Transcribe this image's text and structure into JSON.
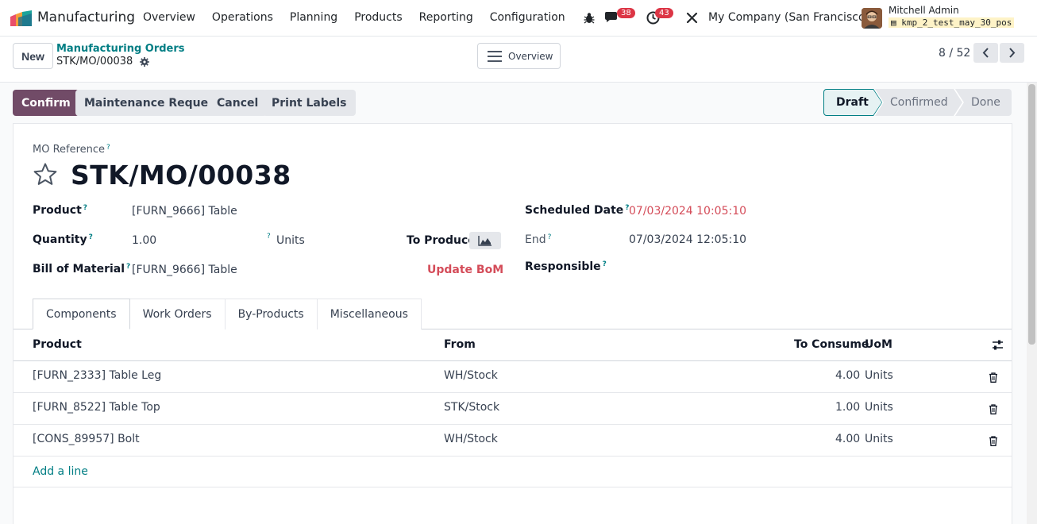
{
  "navbar": {
    "app_name": "Manufacturing",
    "menu": [
      "Overview",
      "Operations",
      "Planning",
      "Products",
      "Reporting",
      "Configuration"
    ],
    "messages_count": "38",
    "activities_count": "43",
    "company": "My Company (San Francisco)",
    "user_name": "Mitchell Admin",
    "database": "kmp_2_test_may_30_pos"
  },
  "control": {
    "new_label": "New",
    "breadcrumb_parent": "Manufacturing Orders",
    "breadcrumb_current": "STK/MO/00038",
    "overview_label": "Overview",
    "pager": "8 / 52"
  },
  "actions": {
    "confirm": "Confirm",
    "maintenance": "Maintenance Request",
    "cancel": "Cancel",
    "print_labels": "Print Labels"
  },
  "stages": [
    "Draft",
    "Confirmed",
    "Done"
  ],
  "stage_active": "Draft",
  "form": {
    "reference_label": "MO Reference",
    "reference": "STK/MO/00038",
    "product_label": "Product",
    "product": "[FURN_9666] Table",
    "quantity_label": "Quantity",
    "quantity": "1.00",
    "quantity_uom": "Units",
    "to_produce_label": "To Produce",
    "bom_label": "Bill of Material",
    "bom": "[FURN_9666] Table",
    "update_bom": "Update BoM",
    "scheduled_label": "Scheduled Date",
    "scheduled": "07/03/2024 10:05:10",
    "end_label": "End",
    "end": "07/03/2024 12:05:10",
    "responsible_label": "Responsible",
    "help_mark": "?"
  },
  "tabs": [
    "Components",
    "Work Orders",
    "By-Products",
    "Miscellaneous"
  ],
  "table": {
    "headers": {
      "product": "Product",
      "from": "From",
      "consume": "To Consume",
      "uom": "UoM"
    },
    "rows": [
      {
        "product": "[FURN_2333] Table Leg",
        "from": "WH/Stock",
        "consume": "4.00",
        "uom": "Units"
      },
      {
        "product": "[FURN_8522] Table Top",
        "from": "STK/Stock",
        "consume": "1.00",
        "uom": "Units"
      },
      {
        "product": "[CONS_89957] Bolt",
        "from": "WH/Stock",
        "consume": "4.00",
        "uom": "Units"
      }
    ],
    "add_line": "Add a line"
  },
  "colors": {
    "brand": "#714b67",
    "link": "#017e84",
    "danger": "#d44c59"
  }
}
